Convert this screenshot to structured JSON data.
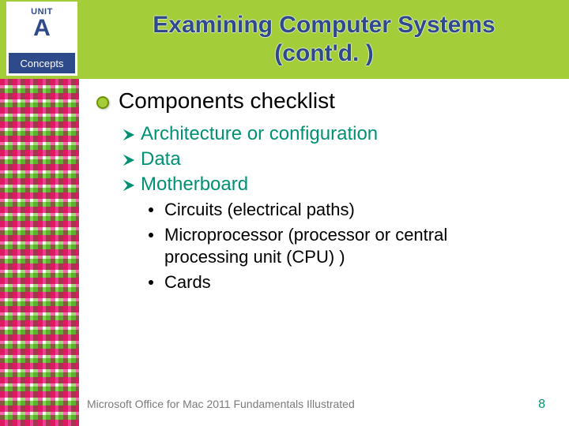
{
  "unit_badge": {
    "label": "UNIT",
    "letter": "A",
    "subtitle": "Concepts"
  },
  "title": {
    "line1": "Examining Computer Systems",
    "line2": "(cont'd. )"
  },
  "bullets": {
    "lvl1": "Components checklist",
    "lvl2": [
      "Architecture or configuration",
      "Data",
      "Motherboard"
    ],
    "lvl3": [
      "Circuits (electrical paths)",
      "Microprocessor (processor or central processing unit (CPU) )",
      "Cards"
    ]
  },
  "footer": {
    "text": "Microsoft Office for Mac 2011 Fundamentals Illustrated",
    "page": "8"
  }
}
